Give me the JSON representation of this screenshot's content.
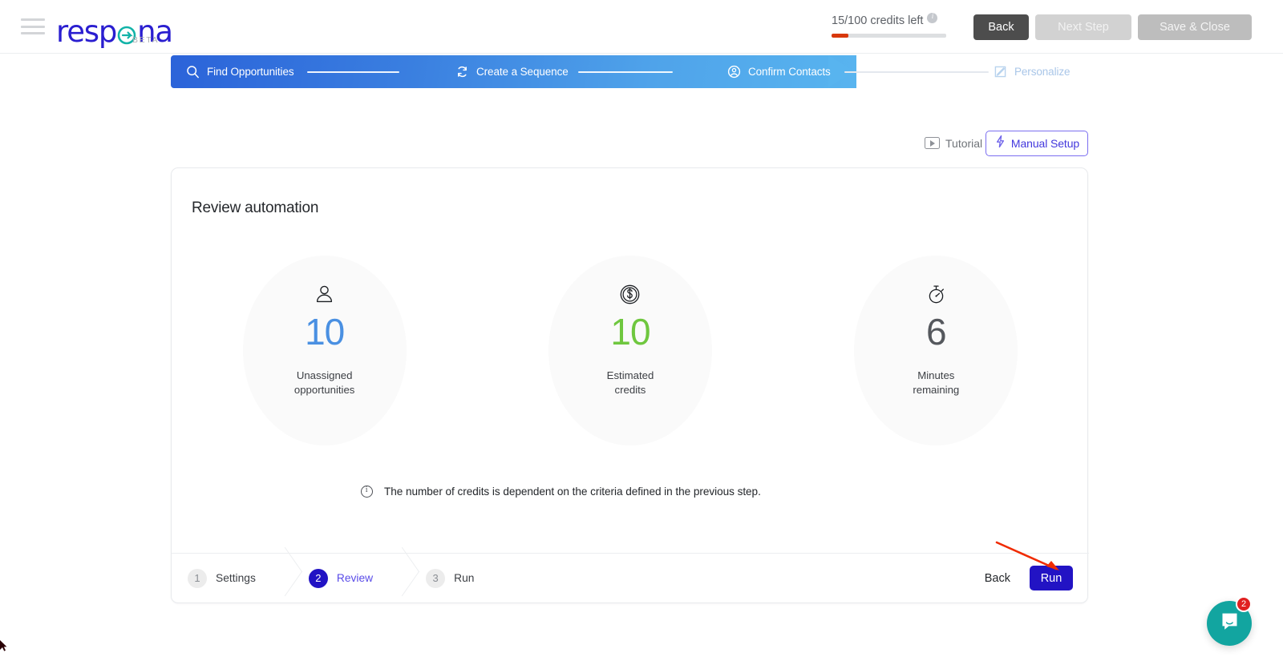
{
  "header": {
    "menu_icon": "hamburger-icon",
    "logo": {
      "text": "respona",
      "badge": "BETA"
    },
    "credits": {
      "text": "15/100 credits left",
      "used": 15,
      "total": 100,
      "percent": 15,
      "info_icon": "info-icon",
      "fill_color": "#d8380c",
      "track_color": "#dddfe1"
    },
    "buttons": {
      "back": "Back",
      "next_step": "Next Step",
      "save_close": "Save & Close"
    }
  },
  "stepper": {
    "steps": [
      {
        "label": "Find Opportunities",
        "icon": "search-icon",
        "state": "done"
      },
      {
        "label": "Create a Sequence",
        "icon": "refresh-icon",
        "state": "done"
      },
      {
        "label": "Confirm Contacts",
        "icon": "user-circle-icon",
        "state": "current"
      },
      {
        "label": "Personalize",
        "icon": "edit-square-icon",
        "state": "upcoming"
      }
    ]
  },
  "toolbar": {
    "tutorial_label": "Tutorial",
    "tutorial_icon": "play-box-icon",
    "manual_setup_label": "Manual Setup",
    "manual_setup_icon": "lightning-icon"
  },
  "card": {
    "title": "Review automation",
    "metrics": [
      {
        "icon": "person-icon",
        "value": "10",
        "value_color": "#4a90e2",
        "label_line1": "Unassigned",
        "label_line2": "opportunities"
      },
      {
        "icon": "coin-dollar-icon",
        "value": "10",
        "value_color": "#6fc73f",
        "label_line1": "Estimated",
        "label_line2": "credits"
      },
      {
        "icon": "stopwatch-icon",
        "value": "6",
        "value_color": "#55585d",
        "label_line1": "Minutes",
        "label_line2": "remaining"
      }
    ],
    "note": {
      "icon": "info-icon",
      "text": "The number of credits is dependent on the criteria defined in the previous step."
    },
    "footer": {
      "steps": [
        {
          "number": "1",
          "label": "Settings",
          "state": "idle"
        },
        {
          "number": "2",
          "label": "Review",
          "state": "active"
        },
        {
          "number": "3",
          "label": "Run",
          "state": "idle"
        }
      ],
      "back_label": "Back",
      "run_label": "Run",
      "run_color": "#2213c4"
    }
  },
  "annotation": {
    "arrow_color": "#f02b00"
  },
  "intercom": {
    "icon": "messenger-icon",
    "badge_count": "2",
    "color": "#12a5a0"
  }
}
